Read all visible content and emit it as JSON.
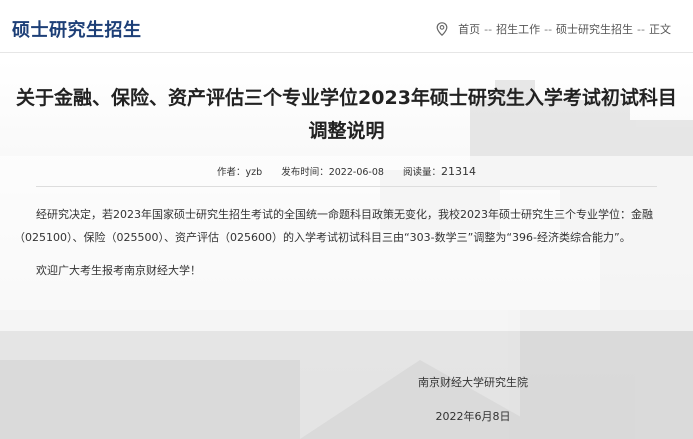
{
  "header": {
    "section_title": "硕士研究生招生",
    "breadcrumb": {
      "home": "首页",
      "sep1": "--",
      "level1": "招生工作",
      "sep2": "--",
      "level2": "硕士研究生招生",
      "sep3": "--",
      "current": "正文"
    }
  },
  "article": {
    "title": "关于金融、保险、资产评估三个专业学位2023年硕士研究生入学考试初试科目调整说明",
    "meta": {
      "author_label": "作者：",
      "author": "yzb",
      "date_label": "发布时间：",
      "date": "2022-06-08",
      "views_label": "阅读量：",
      "views": "21314"
    },
    "paragraph1": "经研究决定，若2023年国家硕士研究生招生考试的全国统一命题科目政策无变化，我校2023年硕士研究生三个专业学位：金融（025100）、保险（025500）、资产评估（025600）的入学考试初试科目三由“303-数学三”调整为“396-经济类综合能力”。",
    "paragraph2": "欢迎广大考生报考南京财经大学！",
    "signature_org": "南京财经大学研究生院",
    "signature_date": "2022年6月8日"
  },
  "colors": {
    "brand": "#1d3f77",
    "text": "#333333"
  },
  "icons": {
    "location": "location-pin-icon"
  }
}
